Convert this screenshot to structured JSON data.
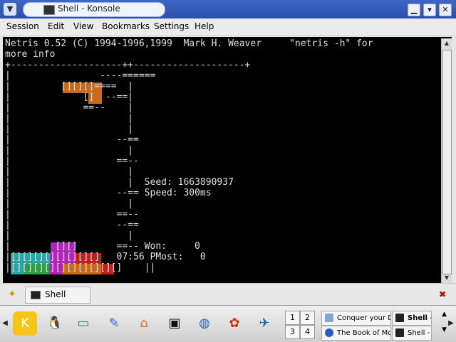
{
  "window": {
    "title": "Shell - Konsole",
    "menu_icon": "chevron-down-icon",
    "buttons": {
      "minimize": "▁",
      "maximize": "▾",
      "close": "✕"
    }
  },
  "menubar": {
    "items": [
      "Session",
      "Edit",
      "View",
      "Bookmarks",
      "Settings",
      "Help"
    ]
  },
  "terminal": {
    "lines": [
      "Netris 0.52 (C) 1994-1996,1999  Mark H. Weaver     \"netris -h\" for",
      "more info",
      "+--------------------++--------------------+",
      "|                ----======",
      "|         [][][]====  |",
      "|             []  --==|",
      "|             ==--    |",
      "|                     |",
      "|                     |",
      "|                   --==",
      "|                     |",
      "|                   ==--",
      "|                     |",
      "|                     |  Seed: 1663890937",
      "|                   --== Speed: 300ms",
      "|                     |",
      "|                   ==--",
      "|                   --==",
      "|                     |",
      "|        [][]       ==-- Won:     0",
      "|[][][][][][][][]   07:56 PMost:   0",
      "|[][][][][][][][][][]    ||"
    ],
    "colors": {
      "text": "#e0e0e0",
      "orange": "#c86a1a",
      "magenta": "#b026b8",
      "cyan": "#2aa6a6",
      "green": "#2ea043",
      "red": "#c02020"
    }
  },
  "tabbar": {
    "new_session_icon": "new-session-icon",
    "tabs": [
      {
        "label": "Shell",
        "icon": "terminal-icon"
      }
    ],
    "close_icon": "close-session-icon"
  },
  "panel": {
    "launchers": [
      {
        "name": "kde-menu-icon",
        "glyph": "K"
      },
      {
        "name": "tux-icon",
        "glyph": "🐧"
      },
      {
        "name": "desktop-icon",
        "glyph": "▭"
      },
      {
        "name": "kcontrol-icon",
        "glyph": "✎"
      },
      {
        "name": "home-icon",
        "glyph": "⌂"
      },
      {
        "name": "konsole-icon",
        "glyph": "▣"
      },
      {
        "name": "konqueror-icon",
        "glyph": "◍"
      },
      {
        "name": "firefox-icon",
        "glyph": "✿"
      },
      {
        "name": "openoffice-icon",
        "glyph": "✈"
      }
    ],
    "pager": [
      "1",
      "2",
      "3",
      "4"
    ],
    "tasks": [
      {
        "label": "Conquer your D",
        "icon": "document-icon",
        "color": "#8aa4d6"
      },
      {
        "label": "Shell -",
        "icon": "terminal-icon",
        "color": "#222222"
      },
      {
        "label": "The Book of Mo",
        "icon": "globe-icon",
        "color": "#2a5bbf"
      },
      {
        "label": "Shell -",
        "icon": "terminal-icon",
        "color": "#222222"
      }
    ]
  }
}
